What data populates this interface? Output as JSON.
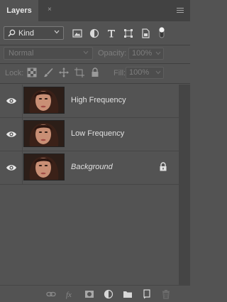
{
  "panel": {
    "tab_title": "Layers",
    "tab_close": "×"
  },
  "filter": {
    "kind_label": "Kind"
  },
  "blend": {
    "mode": "Normal",
    "opacity_label": "Opacity:",
    "opacity_value": "100%"
  },
  "lock": {
    "label": "Lock:",
    "fill_label": "Fill:",
    "fill_value": "100%"
  },
  "layers": [
    {
      "name": "High Frequency",
      "italic": false,
      "locked": false
    },
    {
      "name": "Low Frequency",
      "italic": false,
      "locked": false
    },
    {
      "name": "Background",
      "italic": true,
      "locked": true
    }
  ],
  "colors": {
    "panel_bg": "#535353",
    "tab_bar": "#424242",
    "text": "#e0e0e0",
    "dim_text": "#7e7e7e"
  }
}
